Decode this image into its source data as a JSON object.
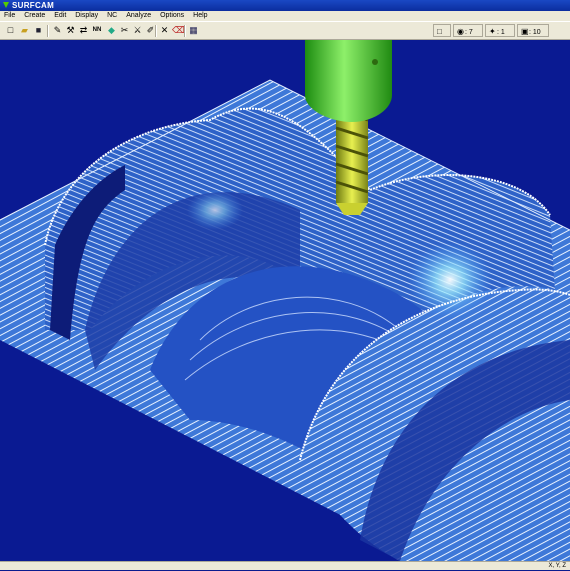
{
  "window": {
    "title": "SURFCAM"
  },
  "menu": {
    "items": [
      "File",
      "Create",
      "Edit",
      "Display",
      "NC",
      "Analyze",
      "Options",
      "Help"
    ]
  },
  "toolbar": {
    "buttons": [
      {
        "name": "new-file-button",
        "icon": "new-file-icon",
        "glyph": "□"
      },
      {
        "name": "open-file-button",
        "icon": "open-folder-icon",
        "glyph": "▰"
      },
      {
        "name": "save-file-button",
        "icon": "save-icon",
        "glyph": "■"
      },
      {
        "name": "edit-button",
        "icon": "edit-icon",
        "glyph": "✎"
      },
      {
        "name": "toolpath-button",
        "icon": "toolpath-icon",
        "glyph": "⚒"
      },
      {
        "name": "transform-button",
        "icon": "transform-icon",
        "glyph": "⇄"
      },
      {
        "name": "nn-button",
        "icon": "nn-icon",
        "glyph": "NN"
      },
      {
        "name": "snap-button",
        "icon": "snap-icon",
        "glyph": "◆"
      },
      {
        "name": "cut-button",
        "icon": "cut-icon",
        "glyph": "✂"
      },
      {
        "name": "trim-button",
        "icon": "trim-icon",
        "glyph": "⚔"
      },
      {
        "name": "paint-button",
        "icon": "paint-icon",
        "glyph": "✐"
      },
      {
        "name": "delete-button",
        "icon": "delete-x-icon",
        "glyph": "✕"
      },
      {
        "name": "erase-button",
        "icon": "erase-icon",
        "glyph": "⌫"
      },
      {
        "name": "calculator-button",
        "icon": "calculator-icon",
        "glyph": "▦"
      }
    ],
    "status": [
      {
        "name": "color-status",
        "icon": "color-square-icon",
        "glyph": "□",
        "value": ""
      },
      {
        "name": "view-status",
        "icon": "eye-icon",
        "glyph": "◉",
        "value": ": 7"
      },
      {
        "name": "level-status",
        "icon": "level-icon",
        "glyph": "✦",
        "value": ": 1"
      },
      {
        "name": "layer-status",
        "icon": "layer-icon",
        "glyph": "▣",
        "value": ": 10"
      }
    ]
  },
  "status_bar": {
    "coords": "X, Y, Z"
  }
}
